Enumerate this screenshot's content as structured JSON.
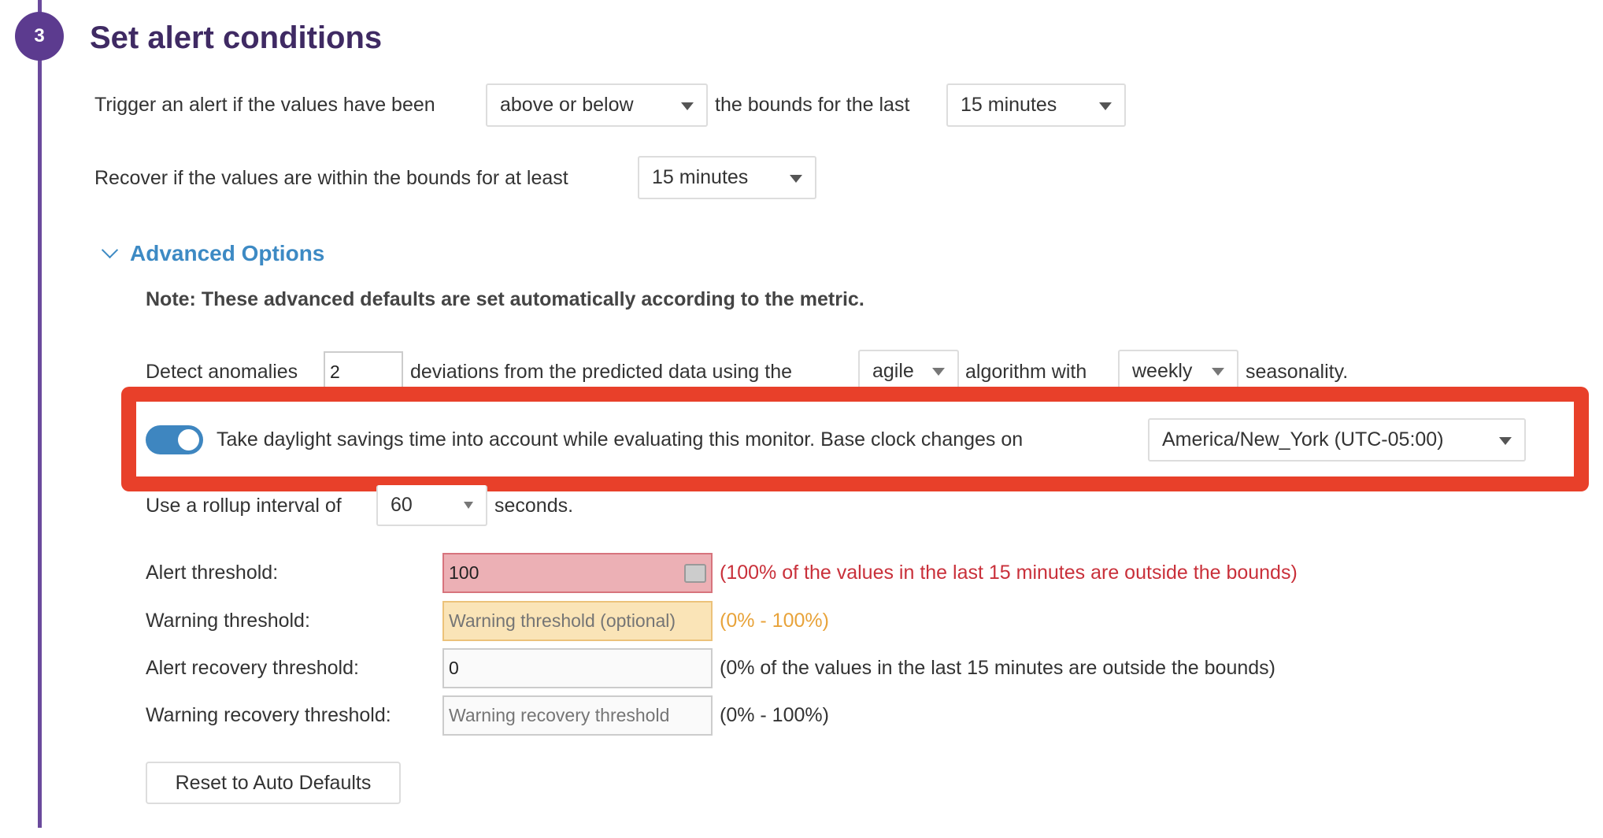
{
  "step": {
    "number": "3",
    "title": "Set alert conditions"
  },
  "trigger": {
    "prefix": "Trigger an alert if the values have been",
    "direction": "above or below",
    "middle": "the bounds for the last",
    "window": "15 minutes"
  },
  "recover": {
    "prefix": "Recover if the values are within the bounds for at least",
    "window": "15 minutes"
  },
  "advanced": {
    "label": "Advanced Options",
    "note": "Note: These advanced defaults are set automatically according to the metric.",
    "detect": {
      "prefix": "Detect anomalies",
      "deviations": "2",
      "middle": "deviations from the predicted data using the",
      "algorithm": "agile",
      "middle2": "algorithm with",
      "seasonality": "weekly",
      "suffix": "seasonality."
    },
    "dst": {
      "enabled": true,
      "label": "Take daylight savings time into account while evaluating this monitor. Base clock changes on",
      "timezone": "America/New_York (UTC-05:00)"
    },
    "rollup": {
      "prefix": "Use a rollup interval of",
      "value": "60",
      "suffix": "seconds."
    },
    "thresholds": {
      "alert": {
        "label": "Alert threshold:",
        "value": "100",
        "hint": "(100% of the values in the last 15 minutes are outside the bounds)"
      },
      "warning": {
        "label": "Warning threshold:",
        "placeholder": "Warning threshold (optional)",
        "hint": "(0% - 100%)"
      },
      "alert_recovery": {
        "label": "Alert recovery threshold:",
        "value": "0",
        "hint": "(0% of the values in the last 15 minutes are outside the bounds)"
      },
      "warning_recovery": {
        "label": "Warning recovery threshold:",
        "placeholder": "Warning recovery threshold",
        "hint": "(0% - 100%)"
      }
    },
    "reset_label": "Reset to Auto Defaults"
  },
  "colors": {
    "step": "#5c3b8f",
    "link": "#3d8ac4",
    "highlight": "#e8402a",
    "alert": "#c9303a",
    "warning": "#e8a33a"
  }
}
